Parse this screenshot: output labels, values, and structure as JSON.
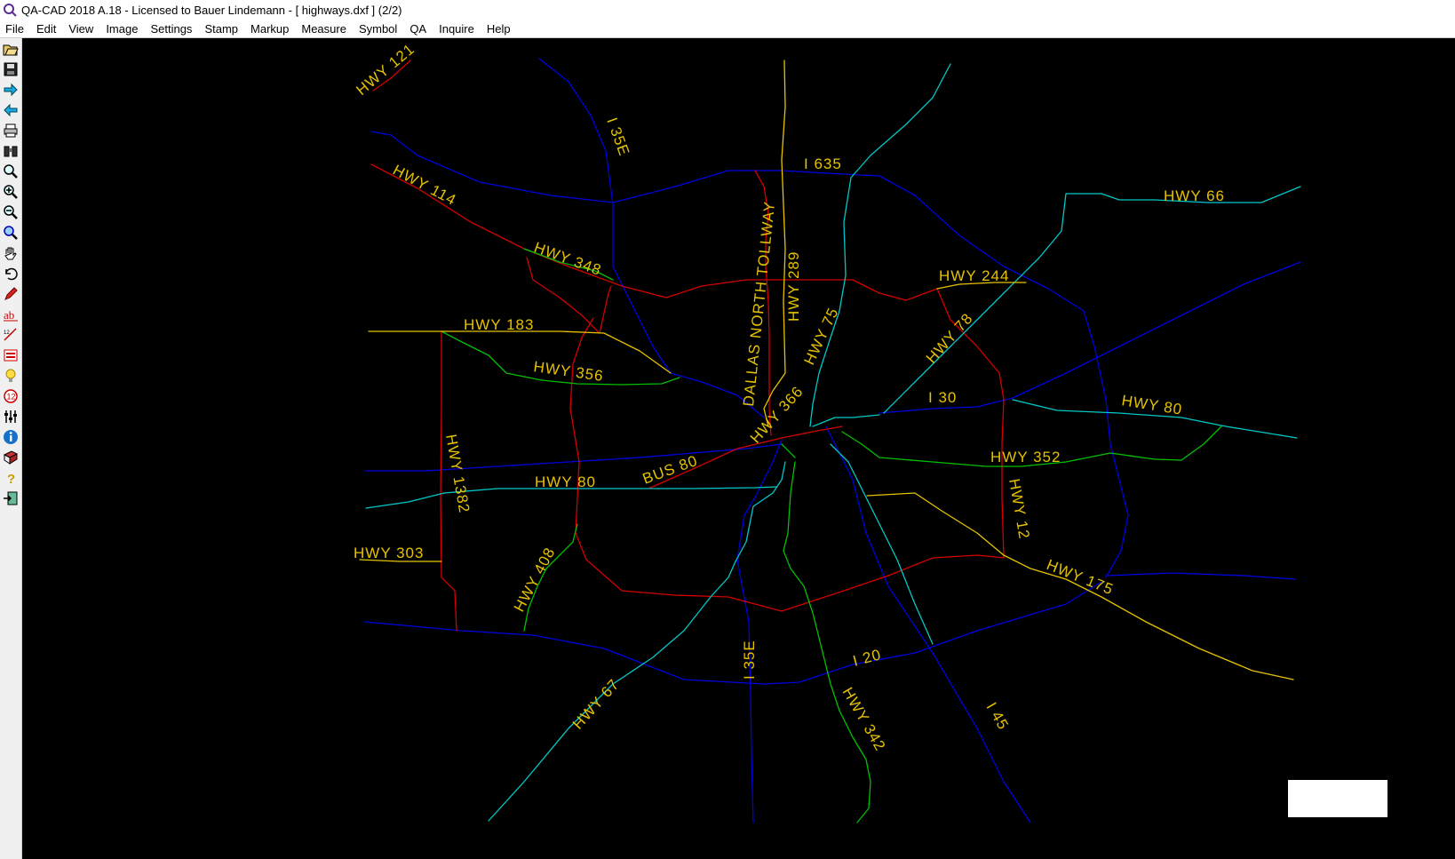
{
  "window": {
    "title": "QA-CAD 2018 A.18 - Licensed to Bauer Lindemann  -  [ highways.dxf ] (2/2)"
  },
  "menu": [
    "File",
    "Edit",
    "View",
    "Image",
    "Settings",
    "Stamp",
    "Markup",
    "Measure",
    "Symbol",
    "QA",
    "Inquire",
    "Help"
  ],
  "toolbar": [
    "open-icon",
    "save-icon",
    "forward-icon",
    "back-icon",
    "print-icon",
    "binoculars-icon",
    "zoom-icon",
    "zoom-in-icon",
    "zoom-out-icon",
    "zoom-window-icon",
    "pan-hand-icon",
    "undo-icon",
    "pen-icon",
    "text-icon",
    "dimension-icon",
    "stamp-icon",
    "bulb-icon",
    "number-icon",
    "layers-icon",
    "info-icon",
    "book-icon",
    "help-icon",
    "exit-icon"
  ],
  "colors": {
    "yellow": "#e6c200",
    "red": "#d40000",
    "blue": "#0000e0",
    "cyan": "#00c8c8",
    "green": "#00c000",
    "background": "#000000"
  },
  "labels": {
    "hwy121": "HWY 121",
    "i35e_n": "I 35E",
    "hwy114": "HWY 114",
    "i635": "I 635",
    "hwy66": "HWY 66",
    "hwy348": "HWY 348",
    "tollway": "DALLAS NORTH TOLLWAY",
    "hwy289": "HWY 289",
    "hwy244": "HWY 244",
    "hwy183": "HWY 183",
    "hwy75": "HWY 75",
    "hwy78": "HWY 78",
    "hwy356": "HWY 356",
    "hwy366": "HWY 366",
    "i30": "I 30",
    "hwy80_e": "HWY 80",
    "hwy1382": "HWY 1382",
    "bus80": "BUS 80",
    "hwy352": "HWY 352",
    "hwy80_w": "HWY 80",
    "hwy12": "HWY 12",
    "hwy303": "HWY 303",
    "hwy408": "HWY 408",
    "hwy175": "HWY 175",
    "i35e_s": "I 35E",
    "i20": "I 20",
    "hwy67": "HWY 67",
    "hwy342": "HWY 342",
    "i45": "I 45"
  }
}
